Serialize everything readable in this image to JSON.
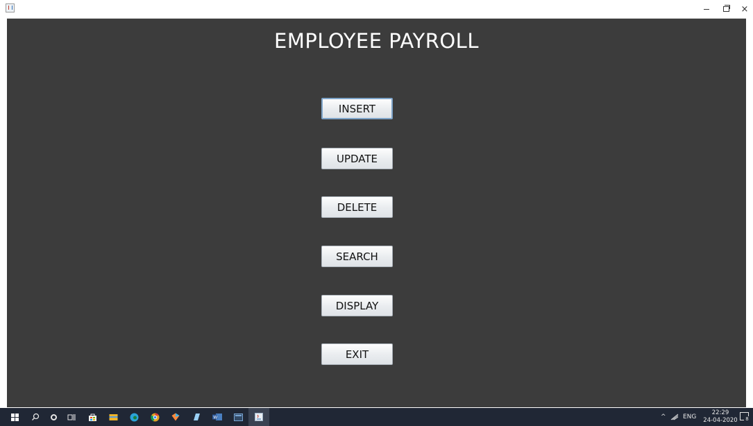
{
  "window": {
    "minimize_glyph": "–",
    "close_glyph": "×"
  },
  "main": {
    "title": "EMPLOYEE PAYROLL",
    "buttons": [
      {
        "label": "INSERT"
      },
      {
        "label": "UPDATE"
      },
      {
        "label": "DELETE"
      },
      {
        "label": "SEARCH"
      },
      {
        "label": "DISPLAY"
      },
      {
        "label": "EXIT"
      }
    ]
  },
  "taskbar": {
    "icons": [
      {
        "name": "start-icon"
      },
      {
        "name": "search-icon"
      },
      {
        "name": "cortana-icon"
      },
      {
        "name": "task-view-icon"
      },
      {
        "name": "store-icon",
        "color": "#f2c94c"
      },
      {
        "name": "file-explorer-icon",
        "color": "#f0b429"
      },
      {
        "name": "edge-icon",
        "color": "#2ba3d8"
      },
      {
        "name": "chrome-icon",
        "color": "#e2a325"
      },
      {
        "name": "app-gem-icon",
        "color": "#ff8a3d"
      },
      {
        "name": "app-notebook-icon",
        "color": "#9ad0f5"
      },
      {
        "name": "word-icon",
        "color": "#2b579a"
      },
      {
        "name": "app-window-icon",
        "color": "#7aa7d6"
      },
      {
        "name": "java-app-icon",
        "color": "#e8eef4"
      }
    ],
    "tray": {
      "language": "ENG",
      "time": "22:29",
      "date": "24-04-2020",
      "notification_count": "8"
    }
  }
}
